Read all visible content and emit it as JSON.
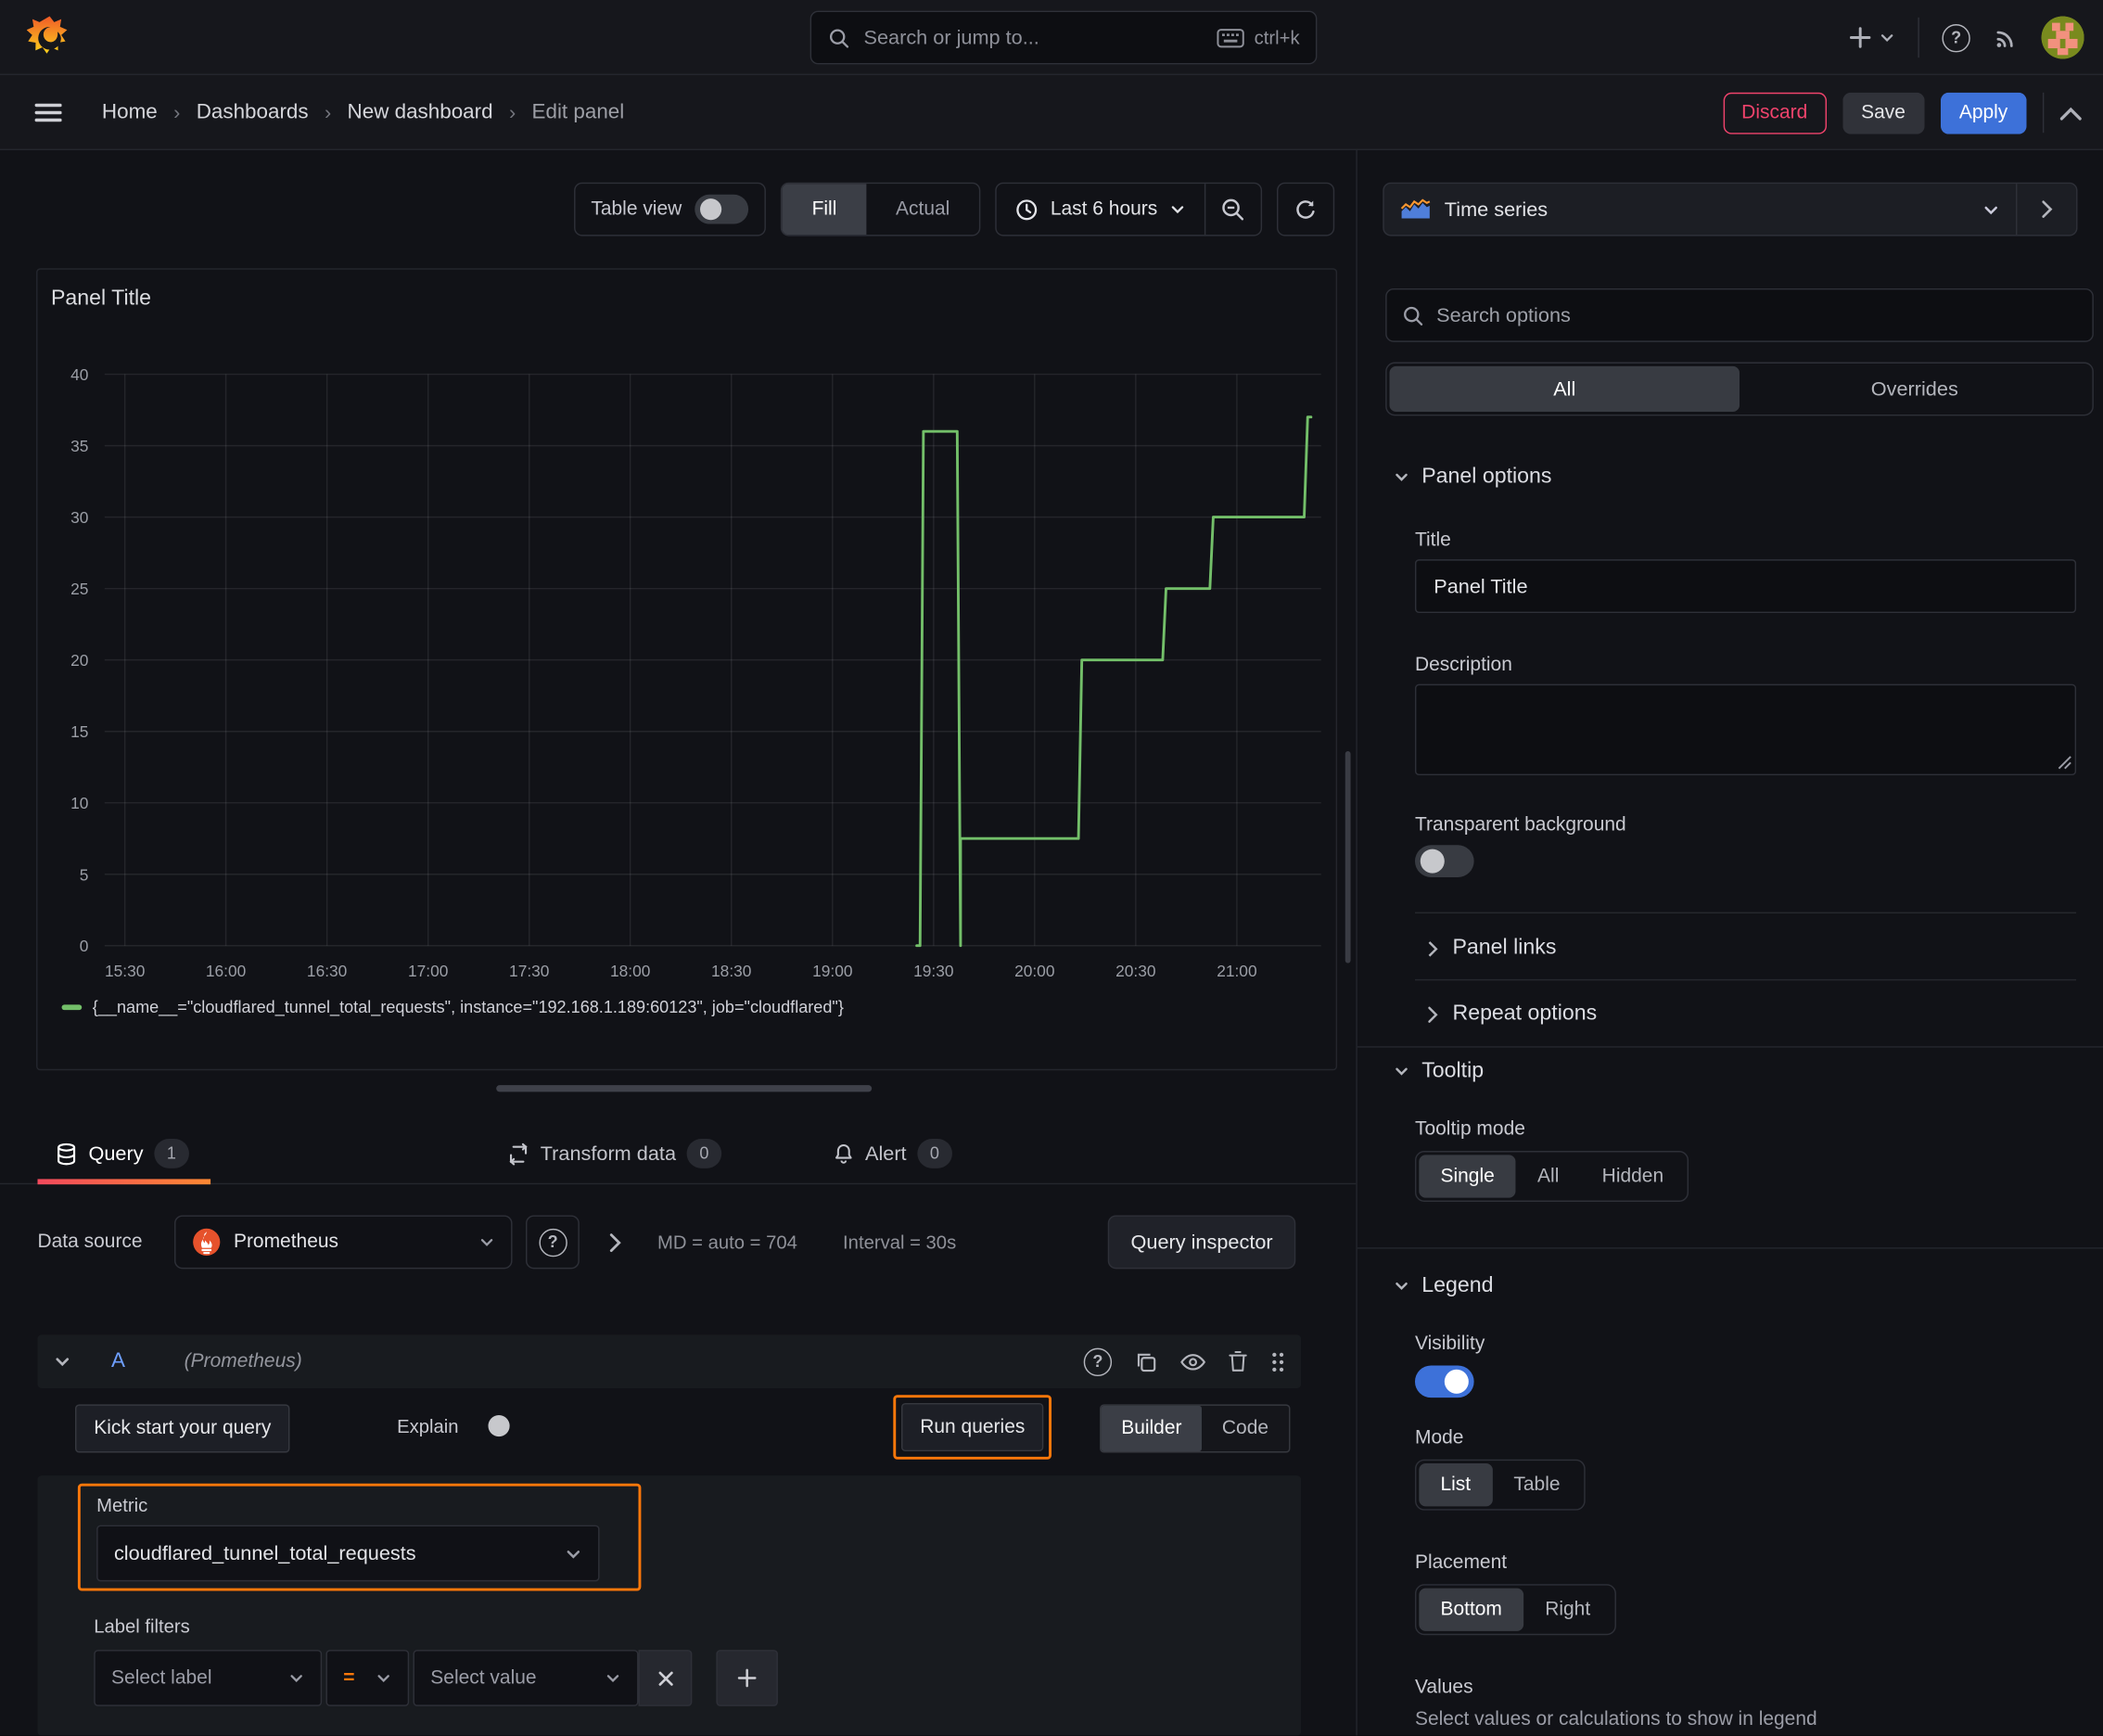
{
  "topbar": {
    "search_placeholder": "Search or jump to...",
    "search_shortcut": "ctrl+k"
  },
  "nav": {
    "breadcrumbs": [
      "Home",
      "Dashboards",
      "New dashboard",
      "Edit panel"
    ],
    "discard_label": "Discard",
    "save_label": "Save",
    "apply_label": "Apply"
  },
  "toolbar": {
    "table_view_label": "Table view",
    "fill_label": "Fill",
    "actual_label": "Actual",
    "time_range_label": "Last 6 hours"
  },
  "viz_picker": {
    "label": "Time series"
  },
  "panel": {
    "title": "Panel Title"
  },
  "chart_data": {
    "type": "line",
    "title": "Panel Title",
    "xlabel": "",
    "ylabel": "",
    "ylim": [
      0,
      40
    ],
    "y_ticks": [
      0,
      5,
      10,
      15,
      20,
      25,
      30,
      35,
      40
    ],
    "x_ticks": [
      "15:30",
      "16:00",
      "16:30",
      "17:00",
      "17:30",
      "18:00",
      "18:30",
      "19:00",
      "19:30",
      "20:00",
      "20:30",
      "21:00"
    ],
    "x_range": [
      "15:24",
      "21:25"
    ],
    "grid": true,
    "legend_position": "bottom",
    "series": [
      {
        "name": "{__name__=\"cloudflared_tunnel_total_requests\", instance=\"192.168.1.189:60123\", job=\"cloudflared\"}",
        "color": "#73bf69",
        "points": [
          [
            "19:25",
            0
          ],
          [
            "19:26",
            0
          ],
          [
            "19:27",
            36
          ],
          [
            "19:37",
            36
          ],
          [
            "19:38",
            0
          ],
          [
            "19:38",
            7.5
          ],
          [
            "20:13",
            7.5
          ],
          [
            "20:14",
            20
          ],
          [
            "20:38",
            20
          ],
          [
            "20:39",
            25
          ],
          [
            "20:52",
            25
          ],
          [
            "20:53",
            30
          ],
          [
            "21:20",
            30
          ],
          [
            "21:21",
            37
          ],
          [
            "21:22",
            37
          ]
        ]
      }
    ]
  },
  "query_pane": {
    "tabs": [
      {
        "label": "Query",
        "count": "1"
      },
      {
        "label": "Transform data",
        "count": "0"
      },
      {
        "label": "Alert",
        "count": "0"
      }
    ],
    "datasource": {
      "label": "Data source",
      "value": "Prometheus",
      "stats": "MD = auto = 704",
      "interval": "Interval = 30s",
      "inspector_label": "Query inspector"
    },
    "query": {
      "ref_id": "A",
      "datasource_hint": "(Prometheus)",
      "kickstart_label": "Kick start your query",
      "explain_label": "Explain",
      "run_label": "Run queries",
      "builder_label": "Builder",
      "code_label": "Code",
      "metric": {
        "label": "Metric",
        "value": "cloudflared_tunnel_total_requests"
      },
      "label_filters": {
        "label": "Label filters",
        "select_label_placeholder": "Select label",
        "operator": "=",
        "select_value_placeholder": "Select value"
      }
    }
  },
  "options_pane": {
    "search_placeholder": "Search options",
    "tabs": {
      "all": "All",
      "overrides": "Overrides"
    },
    "panel_options": {
      "title": "Panel options",
      "title_label": "Title",
      "title_value": "Panel Title",
      "description_label": "Description",
      "transparent_label": "Transparent background"
    },
    "collapsed_sections": [
      "Panel links",
      "Repeat options"
    ],
    "tooltip": {
      "title": "Tooltip",
      "mode_label": "Tooltip mode",
      "options": [
        "Single",
        "All",
        "Hidden"
      ],
      "selected": "Single"
    },
    "legend": {
      "title": "Legend",
      "visibility_label": "Visibility",
      "mode_label": "Mode",
      "mode_options": [
        "List",
        "Table"
      ],
      "placement_label": "Placement",
      "placement_options": [
        "Bottom",
        "Right"
      ],
      "values_label": "Values",
      "values_hint": "Select values or calculations to show in legend"
    }
  },
  "icons": {
    "question_mark": "?",
    "breadcrumb_separator": "›"
  },
  "colors": {
    "accent_orange": "#ff780a",
    "apply_blue": "#3d71d9",
    "discard_pink": "#f0436c",
    "series_green": "#73bf69"
  }
}
